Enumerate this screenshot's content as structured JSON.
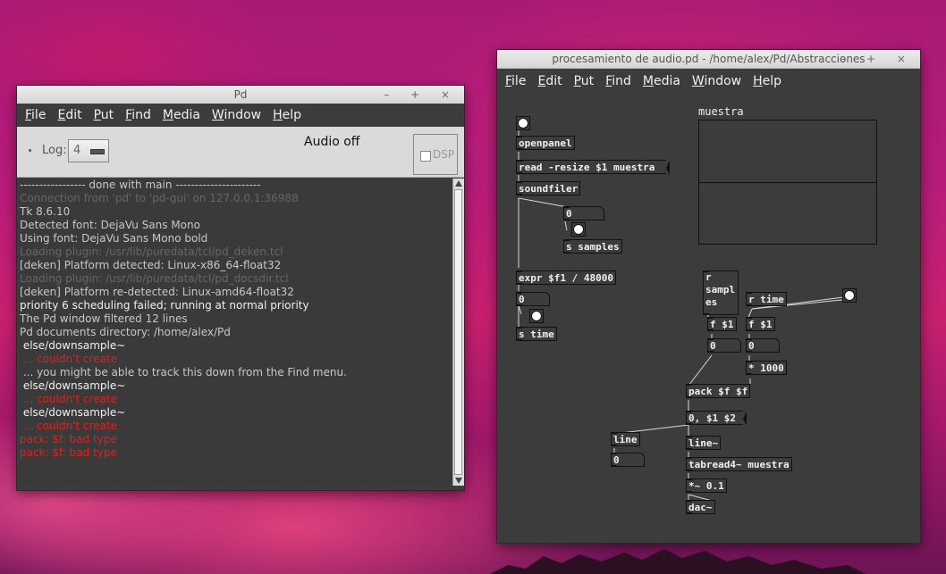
{
  "pd_window": {
    "title": "Pd",
    "controls": "–  +  ×",
    "menu": [
      "File",
      "Edit",
      "Put",
      "Find",
      "Media",
      "Window",
      "Help"
    ],
    "log_label": "Log:",
    "log_level": "4",
    "audio_status": "Audio off",
    "dsp_label": "DSP",
    "console_lines": [
      {
        "text": "----------------- done with main ----------------------",
        "color": "#c8c8c8"
      },
      {
        "text": "Connection from 'pd' to 'pd-gui' on 127.0.0.1:36988",
        "color": "#666666"
      },
      {
        "text": "Tk 8.6.10",
        "color": "#c8c8c8"
      },
      {
        "text": "Detected font: DejaVu Sans Mono",
        "color": "#c8c8c8"
      },
      {
        "text": "Using font: DejaVu Sans Mono bold",
        "color": "#c8c8c8"
      },
      {
        "text": "Loading plugin: /usr/lib/puredata/tcl/pd_deken.tcl",
        "color": "#666666"
      },
      {
        "text": "[deken] Platform detected: Linux-x86_64-float32",
        "color": "#c8c8c8"
      },
      {
        "text": "Loading plugin: /usr/lib/puredata/tcl/pd_docsdir.tcl",
        "color": "#666666"
      },
      {
        "text": "[deken] Platform re-detected: Linux-amd64-float32",
        "color": "#c8c8c8"
      },
      {
        "text": "priority 6 scheduling failed; running at normal priority",
        "color": "#f0f0f0"
      },
      {
        "text": "The Pd window filtered 12 lines",
        "color": "#c8c8c8"
      },
      {
        "text": "Pd documents directory: /home/alex/Pd",
        "color": "#c8c8c8"
      },
      {
        "text": " else/downsample~",
        "color": "#f0f0f0"
      },
      {
        "text": " ... couldn't create",
        "color": "#e02020"
      },
      {
        "text": " ... you might be able to track this down from the Find menu.",
        "color": "#c8c8c8"
      },
      {
        "text": " else/downsample~",
        "color": "#f0f0f0"
      },
      {
        "text": " ... couldn't create",
        "color": "#e02020"
      },
      {
        "text": " else/downsample~",
        "color": "#f0f0f0"
      },
      {
        "text": " ... couldn't create",
        "color": "#e02020"
      },
      {
        "text": "pack: $f: bad type",
        "color": "#e02020"
      },
      {
        "text": "pack: $f: bad type",
        "color": "#e02020"
      }
    ]
  },
  "patch_window": {
    "title": "procesamiento de audio.pd  - /home/alex/Pd/Abstracciones",
    "controls": "–  +  ×",
    "menu": [
      "File",
      "Edit",
      "Put",
      "Find",
      "Media",
      "Window",
      "Help"
    ],
    "array_name": "muestra",
    "objects": {
      "openpanel": "openpanel",
      "read_msg": "read -resize $1 muestra",
      "soundfiler": "soundfiler",
      "num1": "0",
      "s_samples": "s samples",
      "expr": "expr $f1 / 48000",
      "num2": "0",
      "s_time": "s time",
      "r_samples": "r\nsampl\nes",
      "r_time": "r time",
      "f1a": "f $1",
      "f1b": "f $1",
      "num3": "0",
      "num4": "0",
      "mul1000": "* 1000",
      "pack": "pack $f $f",
      "msg_line": "0, $1 $2",
      "line": "line",
      "num5": "0",
      "line_tilde": "line~",
      "tabread": "tabread4~ muestra",
      "mul01": "*~ 0.1",
      "dac": "dac~"
    }
  }
}
